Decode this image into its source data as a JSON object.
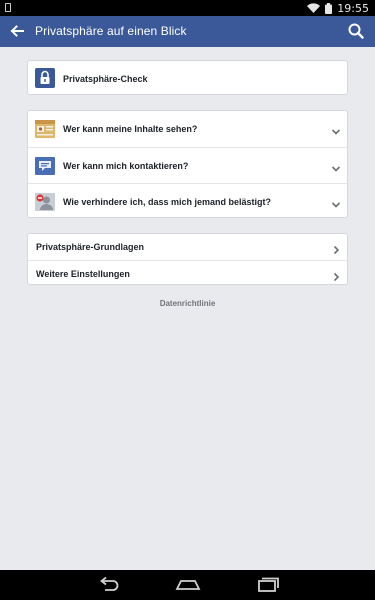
{
  "status_bar": {
    "time": "19:55",
    "icons": [
      "sim-icon",
      "wifi-icon",
      "battery-icon"
    ]
  },
  "app_bar": {
    "title": "Privatsphäre auf einen Blick",
    "back_icon": "arrow-left-icon",
    "search_icon": "search-icon",
    "color": "#3b5998"
  },
  "privacy_check": {
    "label": "Privatsphäre-Check",
    "icon": "lock-icon",
    "icon_color": "#3b5998"
  },
  "settings": {
    "items": [
      {
        "label": "Wer kann meine Inhalte sehen?",
        "icon": "photo-card-icon"
      },
      {
        "label": "Wer kann mich kontaktieren?",
        "icon": "message-bubble-icon"
      },
      {
        "label": "Wie verhindere ich, dass mich jemand belästigt?",
        "icon": "blocked-person-icon"
      }
    ]
  },
  "links": {
    "items": [
      {
        "label": "Privatsphäre-Grundlagen"
      },
      {
        "label": "Weitere Einstellungen"
      }
    ]
  },
  "footer": {
    "policy_label": "Datenrichtlinie"
  },
  "nav_bar": {
    "icons": [
      "nav-back-icon",
      "nav-home-icon",
      "nav-recent-apps-icon"
    ]
  }
}
